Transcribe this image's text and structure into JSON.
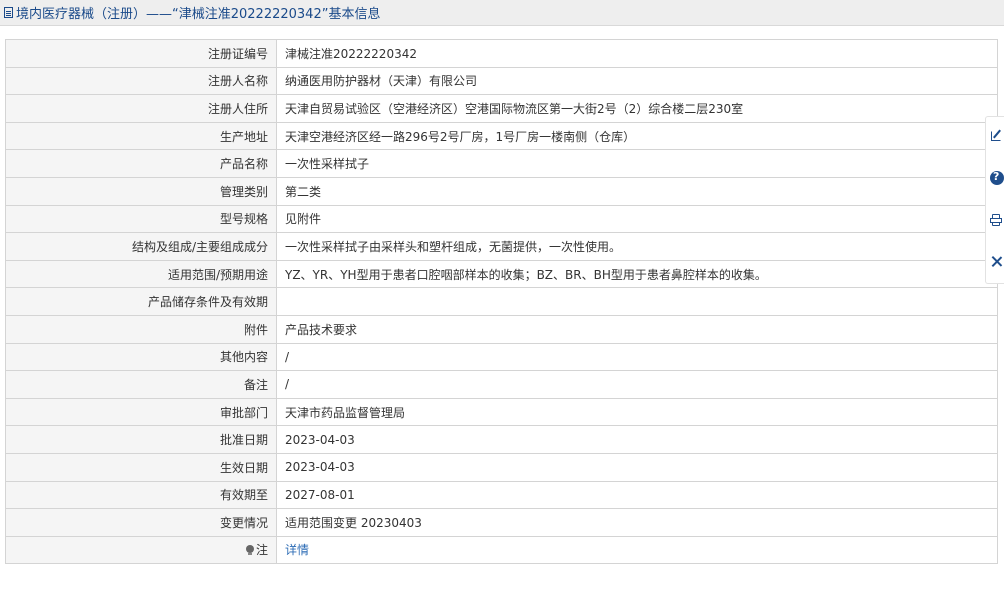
{
  "page": {
    "title": "境内医疗器械（注册）——“津械注准20222220342”基本信息"
  },
  "rows": [
    {
      "label": "注册证编号",
      "value": "津械注准20222220342"
    },
    {
      "label": "注册人名称",
      "value": "纳通医用防护器材（天津）有限公司"
    },
    {
      "label": "注册人住所",
      "value": "天津自贸易试验区（空港经济区）空港国际物流区第一大街2号（2）综合楼二层230室"
    },
    {
      "label": "生产地址",
      "value": "天津空港经济区经一路296号2号厂房，1号厂房一楼南侧（仓库）"
    },
    {
      "label": "产品名称",
      "value": "一次性采样拭子"
    },
    {
      "label": "管理类别",
      "value": "第二类"
    },
    {
      "label": "型号规格",
      "value": "见附件"
    },
    {
      "label": "结构及组成/主要组成成分",
      "value": "一次性采样拭子由采样头和塑杆组成，无菌提供，一次性使用。"
    },
    {
      "label": "适用范围/预期用途",
      "value": "YZ、YR、YH型用于患者口腔咽部样本的收集；BZ、BR、BH型用于患者鼻腔样本的收集。"
    },
    {
      "label": "产品储存条件及有效期",
      "value": ""
    },
    {
      "label": "附件",
      "value": "产品技术要求"
    },
    {
      "label": "其他内容",
      "value": "/"
    },
    {
      "label": "备注",
      "value": "/"
    },
    {
      "label": "审批部门",
      "value": "天津市药品监督管理局"
    },
    {
      "label": "批准日期",
      "value": "2023-04-03"
    },
    {
      "label": "生效日期",
      "value": "2023-04-03"
    },
    {
      "label": "有效期至",
      "value": "2027-08-01"
    },
    {
      "label": "变更情况",
      "value": "适用范围变更 20230403"
    }
  ],
  "note_row": {
    "label": "注",
    "link": "详情"
  },
  "icons": {
    "title_icon": "document-icon",
    "note_icon": "lightbulb-icon",
    "side_tools": [
      "edit-icon",
      "help-icon",
      "print-icon",
      "close-icon"
    ]
  },
  "colors": {
    "title_text": "#1a4a8a",
    "link": "#2b6bb5",
    "label_bg": "#f5f5f5",
    "border": "#d4d4d4",
    "tool_icon": "#1f4e8c"
  }
}
